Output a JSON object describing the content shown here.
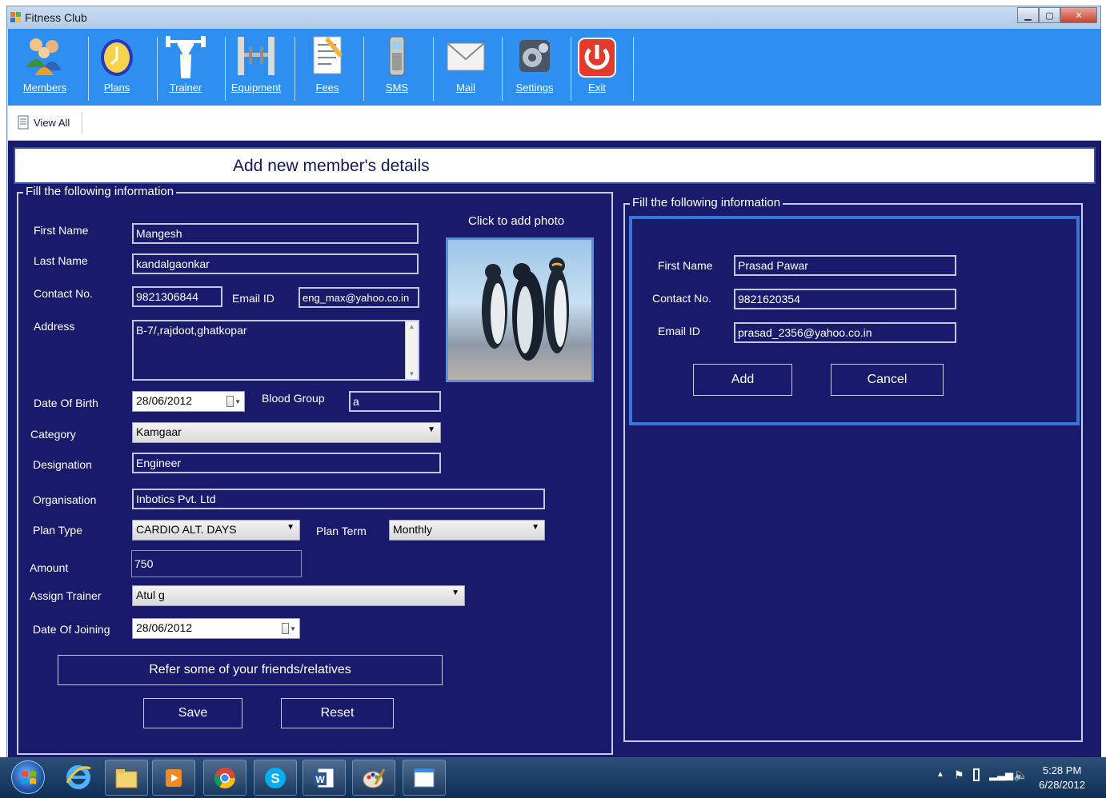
{
  "window": {
    "title": "Fitness Club",
    "controls": [
      "minimize",
      "maximize",
      "close"
    ]
  },
  "toolbar": {
    "items": [
      {
        "label": "Members",
        "icon": "members-icon"
      },
      {
        "label": "Plans",
        "icon": "plans-icon"
      },
      {
        "label": "Trainer",
        "icon": "trainer-icon"
      },
      {
        "label": "Equipment",
        "icon": "equipment-icon"
      },
      {
        "label": "Fees",
        "icon": "fees-icon"
      },
      {
        "label": "SMS",
        "icon": "sms-icon"
      },
      {
        "label": "Mail",
        "icon": "mail-icon"
      },
      {
        "label": "Settings",
        "icon": "settings-icon"
      },
      {
        "label": "Exit",
        "icon": "exit-icon"
      }
    ]
  },
  "subbar": {
    "view_all": "View All"
  },
  "header": {
    "title": "Add new member's details"
  },
  "left_form": {
    "legend": "Fill the following information",
    "first_name_label": "First Name",
    "first_name": "Mangesh",
    "last_name_label": "Last Name",
    "last_name": "kandalgaonkar",
    "contact_label": "Contact No.",
    "contact": "9821306844",
    "email_label": "Email ID",
    "email": "eng_max@yahoo.co.in",
    "address_label": "Address",
    "address": "B-7/,rajdoot,ghatkopar",
    "dob_label": "Date Of Birth",
    "dob": "28/06/2012",
    "blood_group_label": "Blood Group",
    "blood_group": "a",
    "category_label": "Category",
    "category": "Kamgaar",
    "designation_label": "Designation",
    "designation": "Engineer",
    "organisation_label": "Organisation",
    "organisation": "Inbotics Pvt. Ltd",
    "plan_type_label": "Plan Type",
    "plan_type": "CARDIO ALT. DAYS",
    "plan_term_label": "Plan Term",
    "plan_term": "Monthly",
    "amount_label": "Amount",
    "amount": "750",
    "trainer_label": "Assign Trainer",
    "trainer": "Atul g",
    "doj_label": "Date Of Joining",
    "doj": "28/06/2012",
    "photo_label": "Click to add photo",
    "refer_button": "Refer some of your friends/relatives",
    "save_button": "Save",
    "reset_button": "Reset"
  },
  "right_form": {
    "legend": "Fill the following information",
    "first_name_label": "First Name",
    "first_name": "Prasad Pawar",
    "contact_label": "Contact No.",
    "contact": "9821620354",
    "email_label": "Email ID",
    "email": "prasad_2356@yahoo.co.in",
    "add_button": "Add",
    "cancel_button": "Cancel"
  },
  "taskbar": {
    "time": "5:28 PM",
    "date": "6/28/2012"
  },
  "colors": {
    "form_background": "#1a1a6c",
    "toolbar_background": "#2f8ff0",
    "panel_border": "#3576d9"
  }
}
